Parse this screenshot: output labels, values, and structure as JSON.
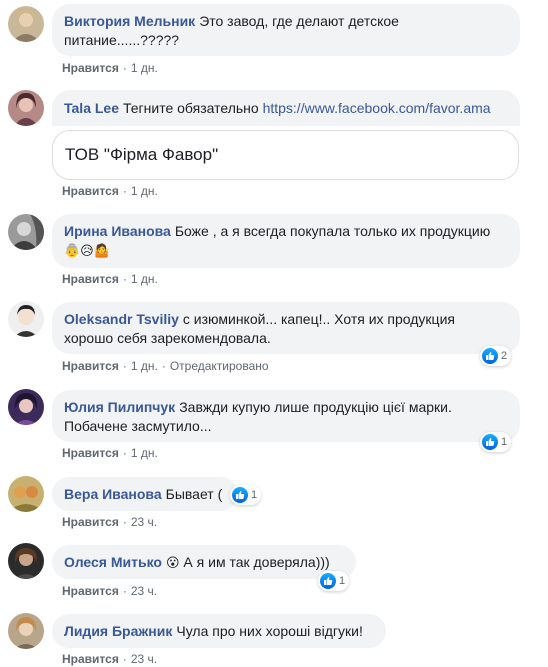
{
  "comments": [
    {
      "author": "Виктория Мельник",
      "text": "Это завод, где делают детское питание......?????",
      "like_label": "Нравится",
      "time": "1 дн."
    },
    {
      "author": "Tala Lee",
      "text": "Тегните обязательно ",
      "link": "https://www.facebook.com/favor.ama",
      "card_title": "ТОВ \"Фірма Фавор\"",
      "like_label": "Нравится",
      "time": "1 дн."
    },
    {
      "author": "Ирина Иванова",
      "text": "Боже , а я всегда покупала только их продукцию",
      "emojis": "👵😥🤷",
      "like_label": "Нравится",
      "time": "1 дн."
    },
    {
      "author": "Oleksandr Tsviliy",
      "text": "с изюминкой... капец!.. Хотя их продукция хорошо себя зарекомендовала.",
      "like_label": "Нравится",
      "time": "1 дн.",
      "edited": "Отредактировано",
      "reactions": "2"
    },
    {
      "author": "Юлия Пилипчук",
      "text": "Завжди купую лише продукцію цієї марки. Побачене засмутило...",
      "like_label": "Нравится",
      "time": "1 дн.",
      "reactions": "1"
    },
    {
      "author": "Вера Иванова",
      "text": "Бывает (",
      "like_label": "Нравится",
      "time": "23 ч.",
      "reactions": "1"
    },
    {
      "author": "Олеся Митько",
      "emoji": "😮",
      "text": " А я им так доверяла)))",
      "like_label": "Нравится",
      "time": "23 ч.",
      "reactions": "1"
    },
    {
      "author": "Лидия Бражник",
      "text": "Чула про них хороші відгуки!",
      "like_label": "Нравится",
      "time": "23 ч."
    }
  ],
  "colors": {
    "author": "#385898",
    "bubble_bg": "#f2f3f5",
    "meta": "#606770",
    "like_blue": "#1877f2"
  },
  "icons": {
    "like_badge": "thumbs-up-icon"
  }
}
